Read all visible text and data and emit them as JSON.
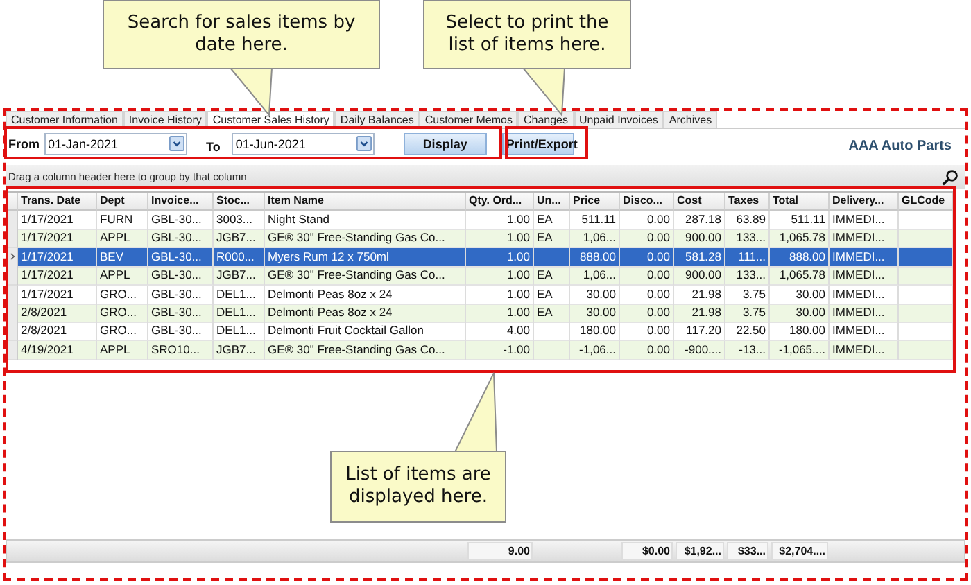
{
  "callouts": [
    {
      "text": "Search for sales items by date here.",
      "kind": "below"
    },
    {
      "text": "Select to print the list of items here.",
      "kind": "below"
    },
    {
      "text": "List of items are displayed here.",
      "kind": "above"
    }
  ],
  "tabs": [
    {
      "label": "Customer Information",
      "selected": false
    },
    {
      "label": "Invoice History",
      "selected": false
    },
    {
      "label": "Customer Sales History",
      "selected": true
    },
    {
      "label": "Daily Balances",
      "selected": false
    },
    {
      "label": "Customer Memos",
      "selected": false
    },
    {
      "label": "Changes",
      "selected": false
    },
    {
      "label": "Unpaid Invoices",
      "selected": false
    },
    {
      "label": "Archives",
      "selected": false
    }
  ],
  "toolbar": {
    "from_label": "From",
    "from_value": "01-Jan-2021",
    "to_label": "To",
    "to_value": "01-Jun-2021",
    "buttons": [
      "Display",
      "Print/Export"
    ],
    "company": "AAA Auto Parts"
  },
  "group_hint": "Drag a column header here to group by that column",
  "columns": [
    {
      "label": "Trans. Date"
    },
    {
      "label": "Dept"
    },
    {
      "label": "Invoice..."
    },
    {
      "label": "Stoc..."
    },
    {
      "label": "Item Name"
    },
    {
      "label": "Qty. Ord...",
      "total": "9.00"
    },
    {
      "label": "Un..."
    },
    {
      "label": "Price"
    },
    {
      "label": "Disco...",
      "total": "$0.00"
    },
    {
      "label": "Cost",
      "total": "$1,92..."
    },
    {
      "label": "Taxes",
      "total": "$33..."
    },
    {
      "label": "Total",
      "total": "$2,704...."
    },
    {
      "label": "Delivery..."
    },
    {
      "label": "GLCode"
    }
  ],
  "rows": [
    {
      "selected": false,
      "cells": [
        "1/17/2021",
        "FURN",
        "GBL-30...",
        "3003...",
        "Night Stand",
        "1.00",
        "EA",
        "511.11",
        "0.00",
        "287.18",
        "63.89",
        "511.11",
        "IMMEDI..."
      ]
    },
    {
      "selected": false,
      "cells": [
        "1/17/2021",
        "APPL",
        "GBL-30...",
        "JGB7...",
        "GE® 30\" Free-Standing Gas Co...",
        "1.00",
        "EA",
        "1,06...",
        "0.00",
        "900.00",
        "133...",
        "1,065.78",
        "IMMEDI..."
      ]
    },
    {
      "selected": true,
      "cells": [
        "1/17/2021",
        "BEV",
        "GBL-30...",
        "R000...",
        "Myers Rum 12 x 750ml",
        "1.00",
        "",
        "888.00",
        "0.00",
        "581.28",
        "111...",
        "888.00",
        "IMMEDI..."
      ]
    },
    {
      "selected": false,
      "cells": [
        "1/17/2021",
        "APPL",
        "GBL-30...",
        "JGB7...",
        "GE® 30\" Free-Standing Gas Co...",
        "1.00",
        "EA",
        "1,06...",
        "0.00",
        "900.00",
        "133...",
        "1,065.78",
        "IMMEDI..."
      ]
    },
    {
      "selected": false,
      "cells": [
        "1/17/2021",
        "GRO...",
        "GBL-30...",
        "DEL1...",
        "Delmonti Peas 8oz x 24",
        "1.00",
        "EA",
        "30.00",
        "0.00",
        "21.98",
        "3.75",
        "30.00",
        "IMMEDI..."
      ]
    },
    {
      "selected": false,
      "cells": [
        "2/8/2021",
        "GRO...",
        "GBL-30...",
        "DEL1...",
        "Delmonti Peas 8oz x 24",
        "1.00",
        "EA",
        "30.00",
        "0.00",
        "21.98",
        "3.75",
        "30.00",
        "IMMEDI..."
      ]
    },
    {
      "selected": false,
      "cells": [
        "2/8/2021",
        "GRO...",
        "GBL-30...",
        "DEL1...",
        "Delmonti Fruit Cocktail  Gallon",
        "4.00",
        "",
        "180.00",
        "0.00",
        "117.20",
        "22.50",
        "180.00",
        "IMMEDI..."
      ]
    },
    {
      "selected": false,
      "cells": [
        "4/19/2021",
        "APPL",
        "SRO10...",
        "JGB7...",
        "GE® 30\" Free-Standing Gas Co...",
        "-1.00",
        "",
        "-1,06...",
        "0.00",
        "-900....",
        "-13...",
        "-1,065....",
        "IMMEDI..."
      ]
    }
  ]
}
